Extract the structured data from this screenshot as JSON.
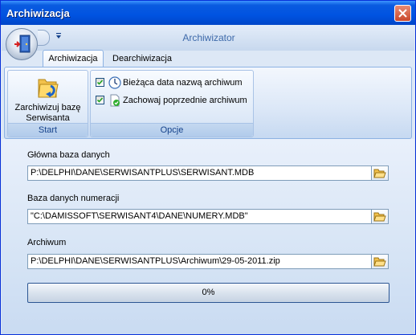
{
  "window": {
    "title": "Archiwizacja"
  },
  "ribbon": {
    "app_title": "Archiwizator",
    "tabs": [
      {
        "label": "Archiwizacja",
        "active": true
      },
      {
        "label": "Dearchiwizacja",
        "active": false
      }
    ],
    "groups": {
      "start": {
        "label": "Start",
        "button_line1": "Zarchiwizuj bazę",
        "button_line2": "Serwisanta",
        "button_icon": "folder-arrow-icon"
      },
      "opcje": {
        "label": "Opcje",
        "options": [
          {
            "label": "Bieżąca data nazwą archiwum",
            "checked": true,
            "icon": "clock-icon"
          },
          {
            "label": "Zachowaj poprzednie archiwum",
            "checked": true,
            "icon": "document-check-icon"
          }
        ]
      }
    }
  },
  "form": {
    "main_db": {
      "label": "Główna baza danych",
      "value": "P:\\DELPHI\\DANE\\SERWISANTPLUS\\SERWISANT.MDB"
    },
    "numbering_db": {
      "label": "Baza danych numeracji",
      "value": "\"C:\\DAMISSOFT\\SERWISANT4\\DANE\\NUMERY.MDB\""
    },
    "archive": {
      "label": "Archiwum",
      "value": "P:\\DELPHI\\DANE\\SERWISANTPLUS\\Archiwum\\29-05-2011.zip"
    }
  },
  "progress": {
    "value": 0,
    "text": "0%"
  },
  "colors": {
    "titlebar": "#0053e1",
    "accent_text": "#15428b",
    "progress_fill": "#47b43b"
  }
}
